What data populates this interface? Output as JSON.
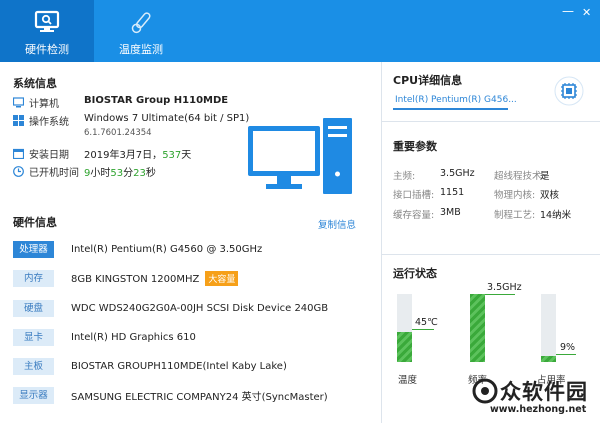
{
  "tabs": [
    {
      "label": "硬件检测"
    },
    {
      "label": "温度监测"
    }
  ],
  "window": {
    "minimize": "—",
    "close": "✕"
  },
  "system": {
    "title": "系统信息",
    "computer_label": "计算机",
    "computer_value": "BIOSTAR Group H110MDE",
    "os_label": "操作系统",
    "os_value": "Windows 7 Ultimate(64 bit / SP1)",
    "os_version": "6.1.7601.24354",
    "install_label": "安装日期",
    "install_date": "2019年3月7日，",
    "install_days": "537",
    "install_days_unit": "天",
    "uptime_label": "已开机时间",
    "uptime": {
      "h": "9",
      "h_unit": "小时",
      "m": "53",
      "m_unit": "分",
      "s": "23",
      "s_unit": "秒"
    }
  },
  "hardware": {
    "title": "硬件信息",
    "copy": "复制信息",
    "rows": [
      {
        "label": "处理器",
        "value": "Intel(R) Pentium(R) G4560 @ 3.50GHz"
      },
      {
        "label": "内存",
        "value": "8GB KINGSTON  1200MHZ",
        "badge": "大容量"
      },
      {
        "label": "硬盘",
        "value": "WDC WDS240G2G0A-00JH SCSI Disk Device 240GB"
      },
      {
        "label": "显卡",
        "value": "Intel(R) HD Graphics 610"
      },
      {
        "label": "主板",
        "value": "BIOSTAR GROUPH110MDE(Intel Kaby Lake)"
      },
      {
        "label": "显示器",
        "value": "SAMSUNG ELECTRIC COMPANY24 英寸(SyncMaster)"
      }
    ]
  },
  "cpu": {
    "title": "CPU详细信息",
    "name": "Intel(R) Pentium(R) G456..."
  },
  "params": {
    "title": "重要参数",
    "items": [
      {
        "k": "主频:",
        "v": "3.5GHz"
      },
      {
        "k": "超线程技术:",
        "v": "是"
      },
      {
        "k": "接口插槽:",
        "v": "1151"
      },
      {
        "k": "物理内核:",
        "v": "双核"
      },
      {
        "k": "缓存容量:",
        "v": "3MB"
      },
      {
        "k": "制程工艺:",
        "v": "14纳米"
      }
    ]
  },
  "status": {
    "title": "运行状态",
    "bars": [
      {
        "label": "温度",
        "value": "45℃",
        "fill": 0.44
      },
      {
        "label": "频率",
        "value": "3.5GHz",
        "fill": 1.0
      },
      {
        "label": "占用率",
        "value": "9%",
        "fill": 0.09
      }
    ]
  },
  "watermark": {
    "brand": "众软件园",
    "url": "www.hezhong.net"
  }
}
